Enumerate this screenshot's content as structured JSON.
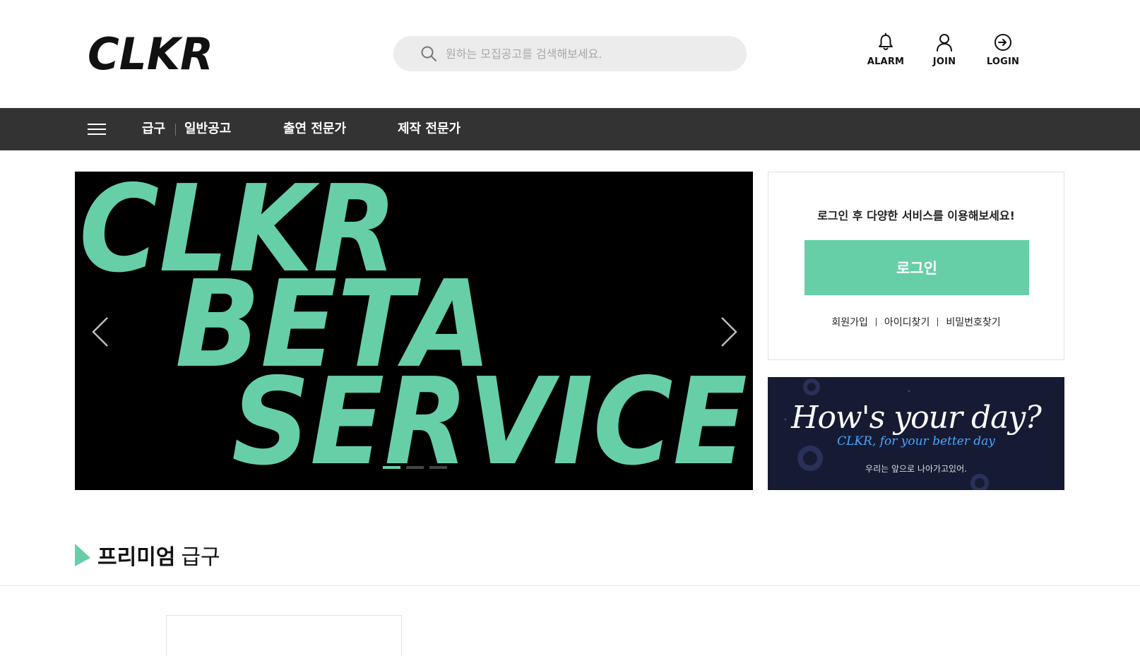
{
  "header": {
    "logo_text": "CLKR",
    "search": {
      "placeholder": "원하는 모집공고를 검색해보세요."
    },
    "utilities": {
      "alarm": "ALARM",
      "join": "JOIN",
      "login": "LOGIN"
    }
  },
  "nav": {
    "items": [
      "급구",
      "일반공고",
      "출연 전문가",
      "제작 전문가"
    ]
  },
  "banner": {
    "headline_lines": [
      "CLKR",
      "BETA",
      "SERVICE"
    ],
    "slides_total": 3,
    "active_slide": 1
  },
  "login_box": {
    "message": "로그인 후 다양한 서비스를 이용해보세요!",
    "button": "로그인",
    "links": [
      "회원가입",
      "아이디찾기",
      "비밀번호찾기"
    ]
  },
  "side_banner": {
    "headline": "How's your day?",
    "sub": "CLKR, for your better day",
    "small": "우리는 앞으로 나아가고있어."
  },
  "section": {
    "title_strong": "프리미엄",
    "title_light": "급구"
  },
  "colors": {
    "accent": "#66cfa8",
    "nav_bg": "#333333",
    "banner_bg": "#000000",
    "side_banner_bg": "#161a33",
    "search_bg": "#ececec"
  }
}
